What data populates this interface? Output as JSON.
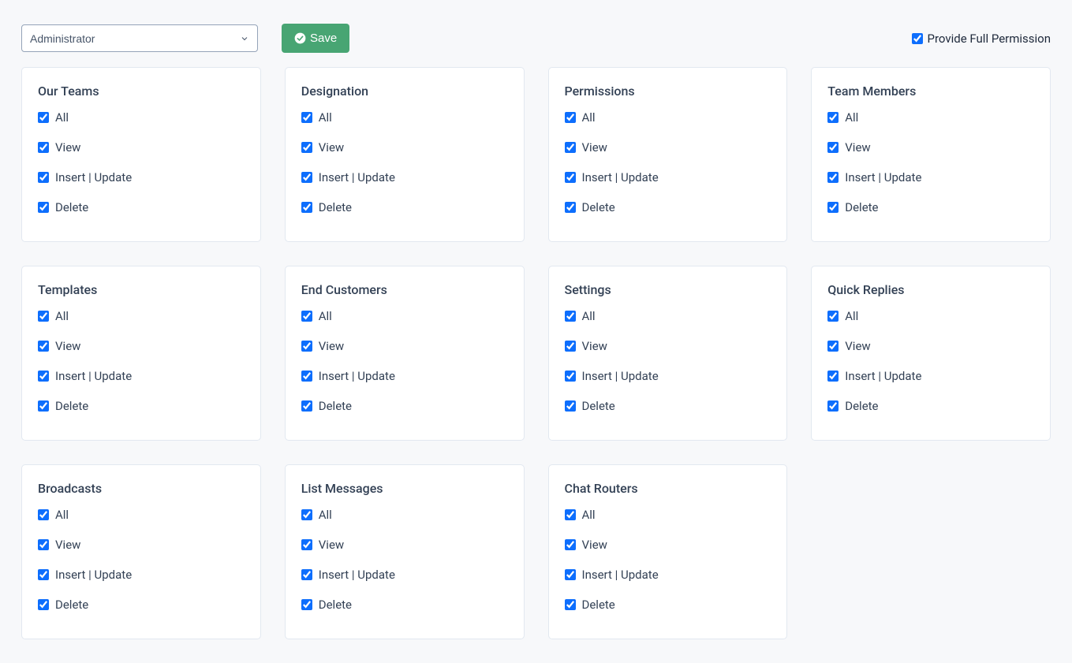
{
  "topbar": {
    "role_selected": "Administrator",
    "save_label": "Save",
    "full_permission_label": "Provide Full Permission",
    "full_permission_checked": true
  },
  "perm_labels": {
    "all": "All",
    "view": "View",
    "insert_update": "Insert | Update",
    "delete": "Delete"
  },
  "sections": [
    {
      "title": "Our Teams",
      "all": true,
      "view": true,
      "insert_update": true,
      "delete": true
    },
    {
      "title": "Designation",
      "all": true,
      "view": true,
      "insert_update": true,
      "delete": true
    },
    {
      "title": "Permissions",
      "all": true,
      "view": true,
      "insert_update": true,
      "delete": true
    },
    {
      "title": "Team Members",
      "all": true,
      "view": true,
      "insert_update": true,
      "delete": true
    },
    {
      "title": "Templates",
      "all": true,
      "view": true,
      "insert_update": true,
      "delete": true
    },
    {
      "title": "End Customers",
      "all": true,
      "view": true,
      "insert_update": true,
      "delete": true
    },
    {
      "title": "Settings",
      "all": true,
      "view": true,
      "insert_update": true,
      "delete": true
    },
    {
      "title": "Quick Replies",
      "all": true,
      "view": true,
      "insert_update": true,
      "delete": true
    },
    {
      "title": "Broadcasts",
      "all": true,
      "view": true,
      "insert_update": true,
      "delete": true
    },
    {
      "title": "List Messages",
      "all": true,
      "view": true,
      "insert_update": true,
      "delete": true
    },
    {
      "title": "Chat Routers",
      "all": true,
      "view": true,
      "insert_update": true,
      "delete": true
    }
  ]
}
